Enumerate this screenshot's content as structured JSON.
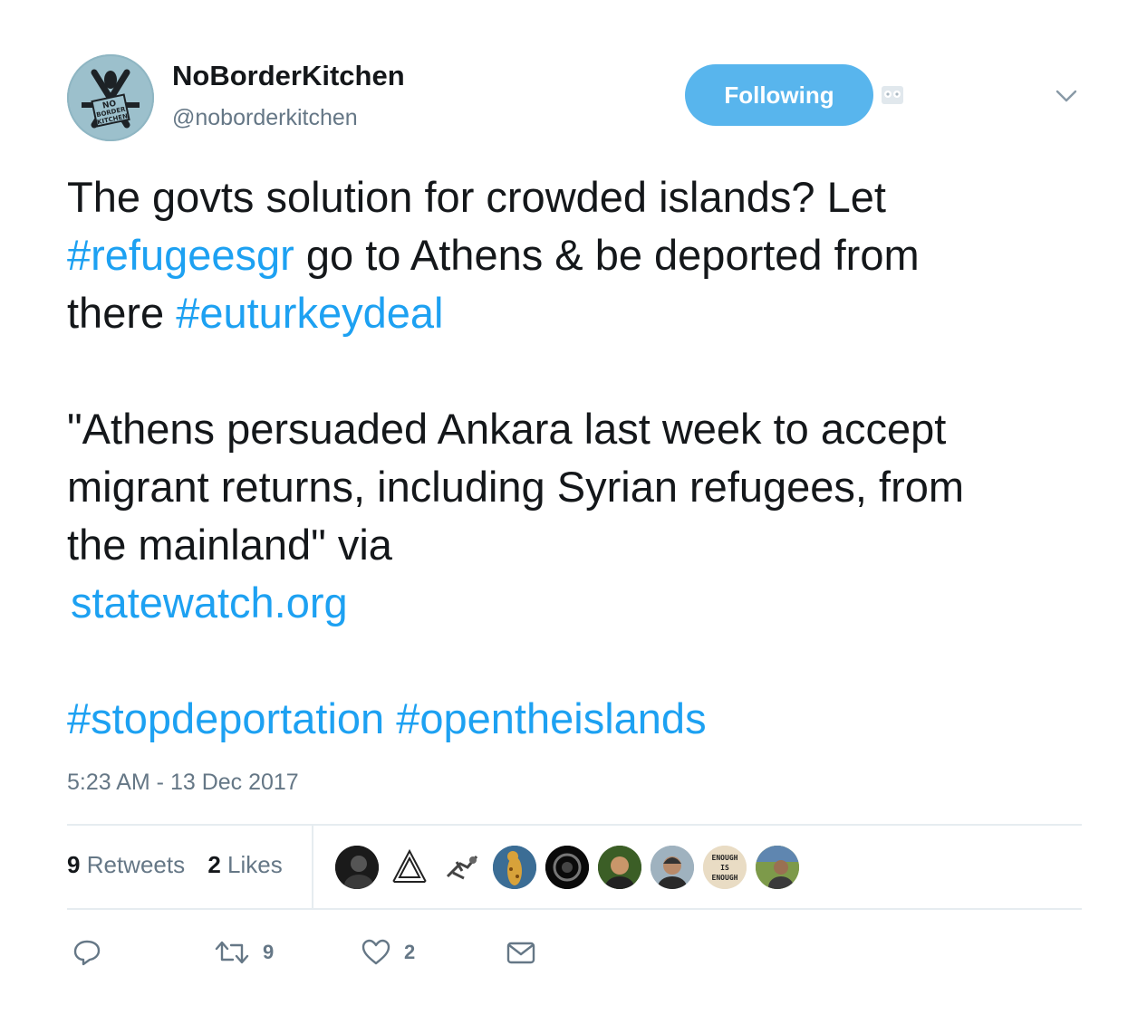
{
  "user": {
    "display_name": "NoBorderKitchen",
    "handle": "@noborderkitchen",
    "avatar_text": [
      "NO",
      "BORDER",
      "KITCHEN"
    ]
  },
  "follow_button": {
    "label": "Following"
  },
  "tweet": {
    "line1_text": "The govts solution for crowded islands? Let",
    "hashtag1": "#refugeesgr",
    "line2_text": " go to Athens & be deported from",
    "line3_text": "there ",
    "hashtag2": "#euturkeydeal",
    "quote": "\"Athens persuaded Ankara last week to accept migrant returns, including Syrian refugees, from the mainland\" via",
    "link": "statewatch.org",
    "hashtag3": "#stopdeportation",
    "hashtag4": "#opentheislands"
  },
  "timestamp": "5:23 AM - 13 Dec 2017",
  "stats": {
    "retweets_count": "9",
    "retweets_label": "Retweets",
    "likes_count": "2",
    "likes_label": "Likes"
  },
  "liker_avatars": [
    "avatar-1",
    "avatar-2",
    "avatar-3",
    "avatar-4",
    "avatar-5",
    "avatar-6",
    "avatar-7",
    "avatar-8",
    "avatar-9"
  ],
  "enough_avatar_text": "ENOUGH IS ENOUGH",
  "actions": {
    "reply_icon": "reply-icon",
    "retweet_icon": "retweet-icon",
    "retweet_count": "9",
    "like_icon": "heart-icon",
    "like_count": "2",
    "dm_icon": "envelope-icon"
  },
  "colors": {
    "link": "#1da1f2",
    "button": "#58b5ed",
    "secondary_text": "#657786",
    "divider": "#e6ecf0"
  }
}
